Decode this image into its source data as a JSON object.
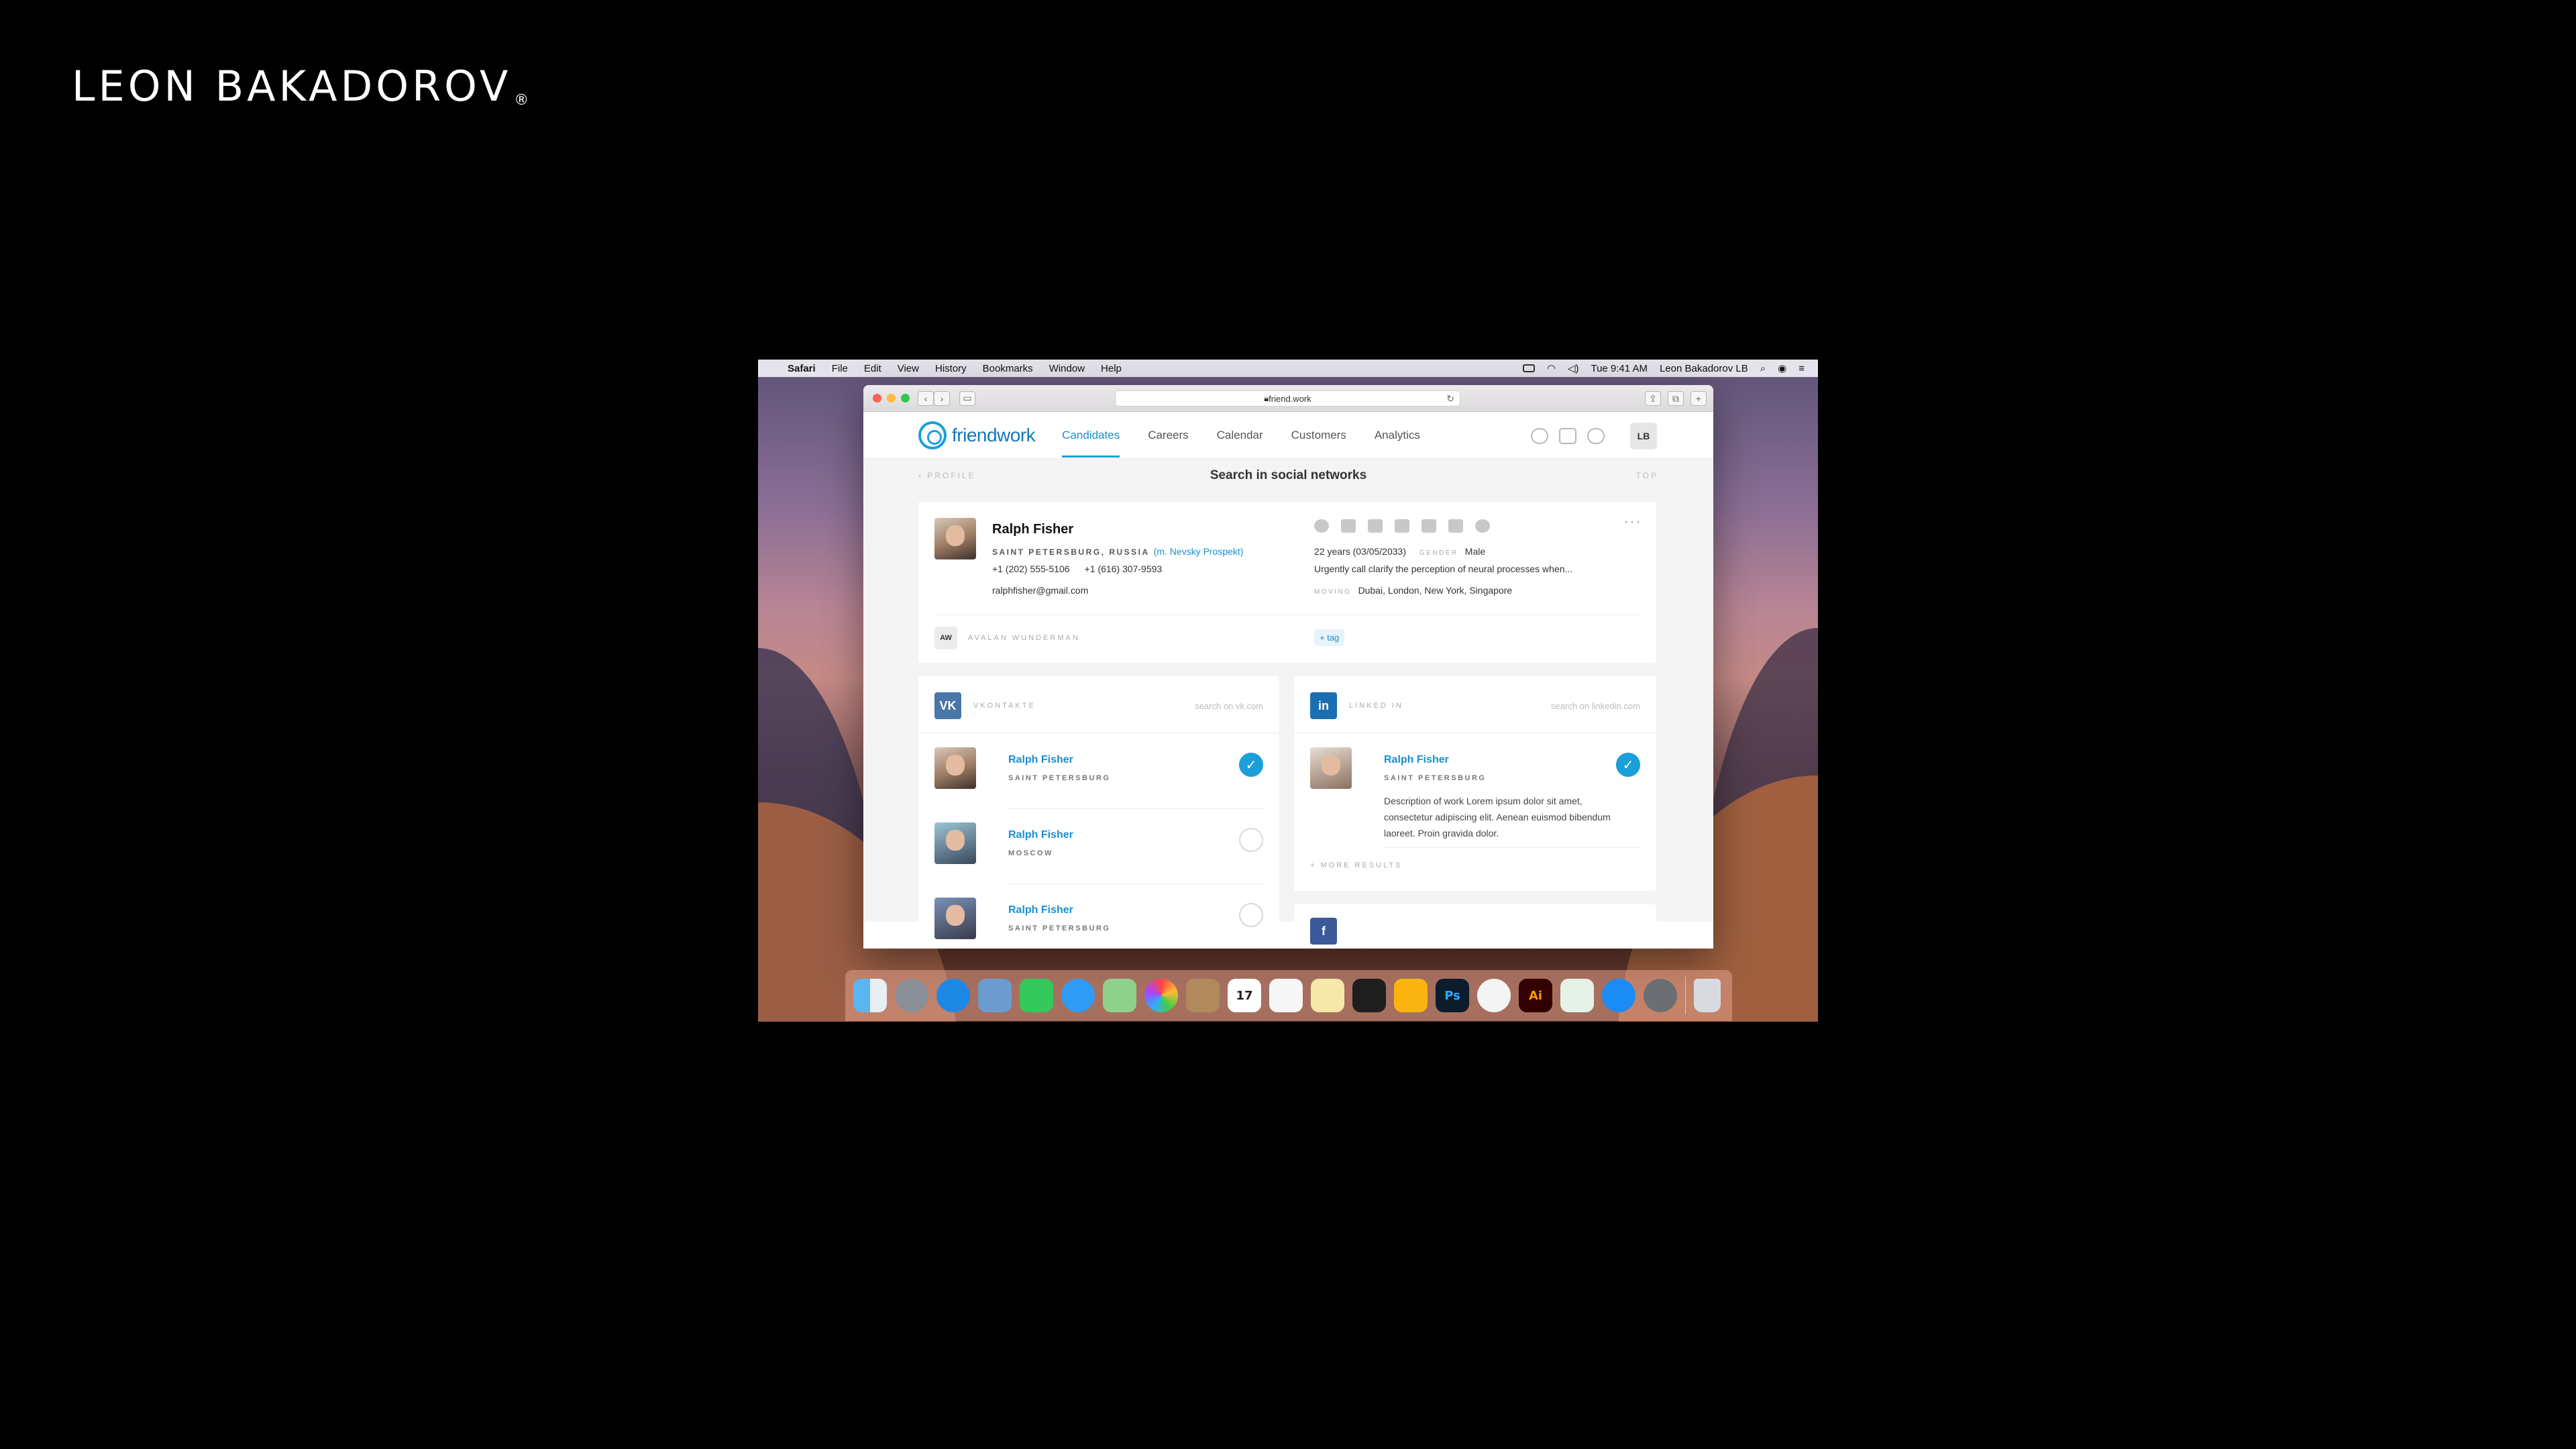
{
  "brand": {
    "name": "LEON BAKADOROV",
    "mark": "®"
  },
  "menubar": {
    "apple": "",
    "app": "Safari",
    "items": [
      "File",
      "Edit",
      "View",
      "History",
      "Bookmarks",
      "Window",
      "Help"
    ],
    "clock": "Tue 9:41 AM",
    "user": "Leon Bakadorov LB"
  },
  "browser": {
    "url": "friend.work",
    "reload": "↻"
  },
  "app": {
    "logo": "friendwork",
    "nav": [
      "Candidates",
      "Careers",
      "Calendar",
      "Customers",
      "Analytics"
    ],
    "user_initials": "LB",
    "back_label": "PROFILE",
    "page_title": "Search in social networks",
    "top_label": "TOP"
  },
  "profile": {
    "name": "Ralph Fisher",
    "city": "SAINT PETERSBURG, RUSSIA",
    "metro": "(m. Nevsky Prospekt)",
    "phone1": "+1 (202) 555-5106",
    "phone2": "+1 (616) 307-9593",
    "email": "ralphfisher@gmail.com",
    "age": "22 years (03/05/2033)",
    "gender_label": "GENDER",
    "gender": "Male",
    "about": "Urgently call clarify the perception of neural processes when...",
    "moving_label": "MOVING",
    "moving": "Dubai, London, New York, Singapore",
    "owner_initials": "AW",
    "owner": "AVALAN WUNDERMAN",
    "tag": "+ tag",
    "more": "···"
  },
  "vk": {
    "badge": "VK",
    "title": "VKONTAKTE",
    "search": "search on vk.com",
    "results": [
      {
        "name": "Ralph Fisher",
        "city": "SAINT PETERSBURG",
        "checked": true
      },
      {
        "name": "Ralph Fisher",
        "city": "MOSCOW",
        "checked": false
      },
      {
        "name": "Ralph Fisher",
        "city": "SAINT PETERSBURG",
        "checked": false
      }
    ]
  },
  "linkedin": {
    "badge": "in",
    "title": "LINKED IN",
    "search": "search on linkedin.com",
    "results": [
      {
        "name": "Ralph Fisher",
        "city": "SAINT PETERSBURG",
        "checked": true,
        "description": "Description of work Lorem ipsum dolor sit amet, consectetur adipiscing elit. Aenean euismod bibendum laoreet. Proin gravida dolor."
      }
    ],
    "more": "+ MORE RESULTS"
  },
  "facebook": {
    "badge": "f"
  },
  "check_mark": "✓",
  "dock": {
    "icons": [
      "finder-icon",
      "launchpad-icon",
      "safari-icon",
      "preview-icon",
      "facetime-icon",
      "messages-icon",
      "maps-icon",
      "photos-icon",
      "contacts-icon",
      "calendar-icon",
      "reminders-icon",
      "notes-icon",
      "figma-icon",
      "sketch-icon",
      "photoshop-icon",
      "music-icon",
      "illustrator-icon",
      "numbers-icon",
      "appstore-icon",
      "settings-icon",
      "trash-icon"
    ],
    "calendar_day": "17",
    "ps_label": "Ps",
    "ai_label": "Ai"
  }
}
